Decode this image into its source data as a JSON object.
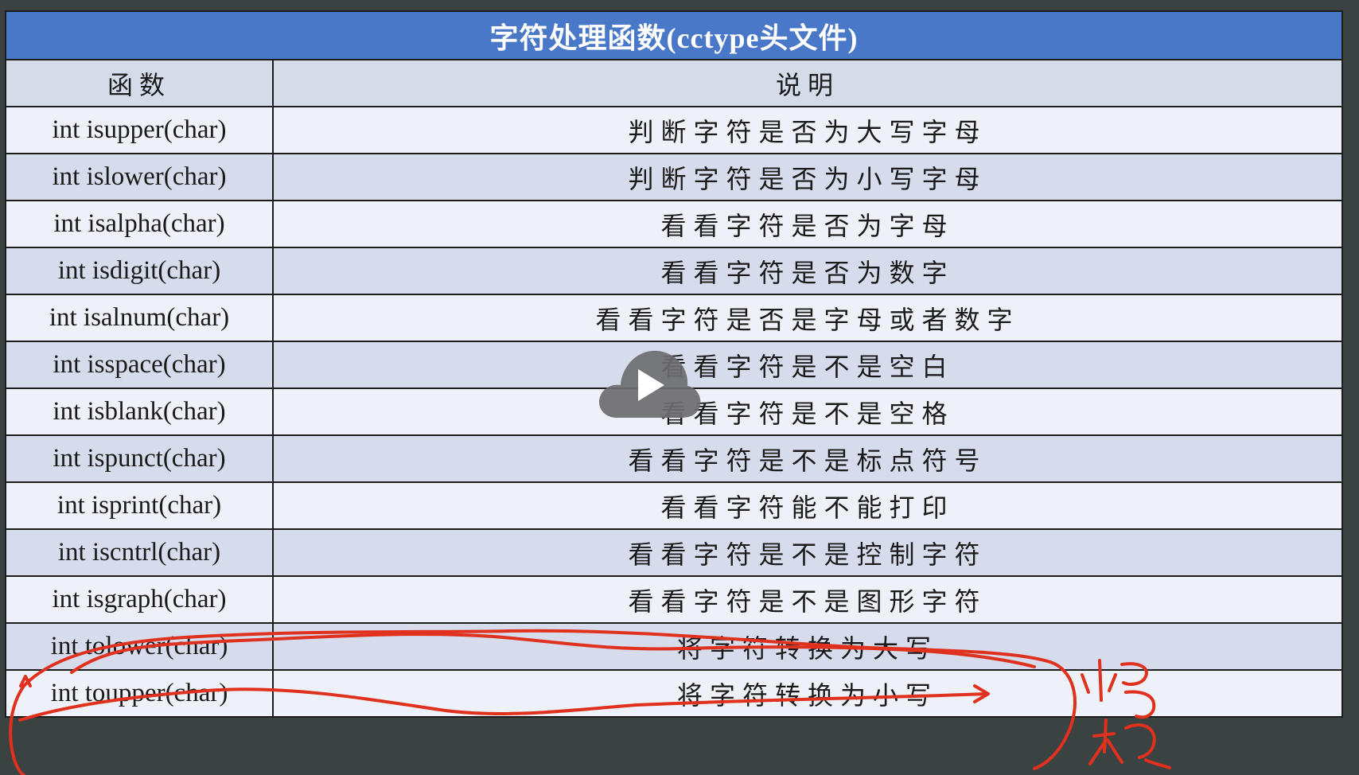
{
  "table": {
    "title": "字符处理函数(cctype头文件)",
    "headers": {
      "function": "函数",
      "description": "说明"
    },
    "rows": [
      {
        "function": "int isupper(char)",
        "description": "判断字符是否为大写字母"
      },
      {
        "function": "int islower(char)",
        "description": "判断字符是否为小写字母"
      },
      {
        "function": "int isalpha(char)",
        "description": "看看字符是否为字母"
      },
      {
        "function": "int isdigit(char)",
        "description": "看看字符是否为数字"
      },
      {
        "function": "int isalnum(char)",
        "description": "看看字符是否是字母或者数字"
      },
      {
        "function": "int isspace(char)",
        "description": "看看字符是不是空白"
      },
      {
        "function": "int isblank(char)",
        "description": "看看字符是不是空格"
      },
      {
        "function": "int ispunct(char)",
        "description": "看看字符是不是标点符号"
      },
      {
        "function": "int isprint(char)",
        "description": "看看字符能不能打印"
      },
      {
        "function": "int iscntrl(char)",
        "description": "看看字符是不是控制字符"
      },
      {
        "function": "int isgraph(char)",
        "description": "看看字符是不是图形字符"
      },
      {
        "function": "int  tolower(char)",
        "description": "将字符转换为大写"
      },
      {
        "function": "int toupper(char)",
        "description": "将字符转换为小写"
      }
    ]
  },
  "video": {
    "play_icon": "play-icon"
  },
  "annotation": {
    "stroke_color": "#e0301e",
    "note_text": "小写 大写"
  },
  "colors": {
    "title_bg": "#4a78c8",
    "header_bg": "#d4dcea",
    "row_light": "#eef1f7",
    "row_dark": "#d6dcec",
    "frame_bg": "#3a4242"
  }
}
